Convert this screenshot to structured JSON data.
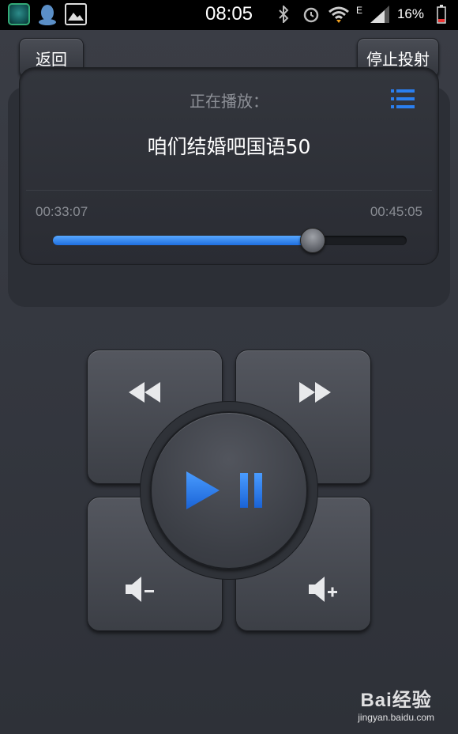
{
  "status_bar": {
    "time": "08:05",
    "network": "E",
    "battery": "16%"
  },
  "header": {
    "back_label": "返回",
    "stop_cast_label": "停止投射"
  },
  "now_playing": {
    "label": "正在播放：",
    "title": "咱们结婚吧国语50",
    "current_time": "00:33:07",
    "total_time": "00:45:05",
    "progress_percent": 73.5
  },
  "controls": {
    "rewind": "rewind-icon",
    "fast_forward": "fast-forward-icon",
    "play_pause": "play-pause-icon",
    "volume_down": "volume-down-icon",
    "volume_up": "volume-up-icon"
  },
  "watermark": {
    "logo": "Bai经验",
    "url": "jingyan.baidu.com"
  },
  "colors": {
    "accent": "#2a7ff0",
    "background": "#353840"
  }
}
